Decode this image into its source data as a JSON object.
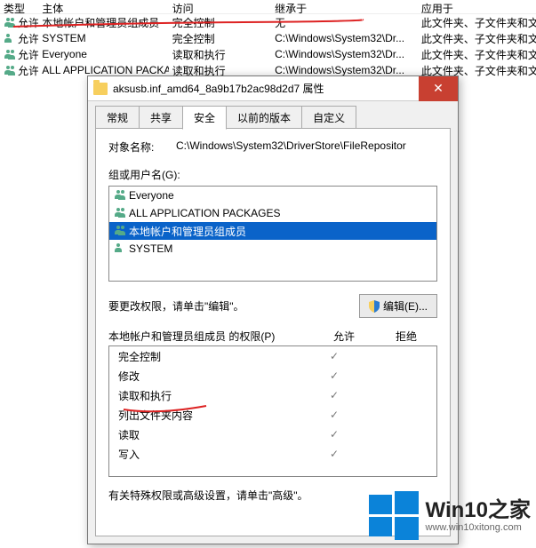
{
  "bg": {
    "headers": {
      "type": "类型",
      "principal": "主体",
      "access": "访问",
      "inherited": "继承于",
      "applies": "应用于"
    },
    "rows": [
      {
        "type": "允许",
        "principal": "本地帐户和管理员组成员",
        "access": "完全控制",
        "inherited": "无",
        "applies": "此文件夹、子文件夹和文件"
      },
      {
        "type": "允许",
        "principal": "SYSTEM",
        "access": "完全控制",
        "inherited": "C:\\Windows\\System32\\Dr...",
        "applies": "此文件夹、子文件夹和文件"
      },
      {
        "type": "允许",
        "principal": "Everyone",
        "access": "读取和执行",
        "inherited": "C:\\Windows\\System32\\Dr...",
        "applies": "此文件夹、子文件夹和文件"
      },
      {
        "type": "允许",
        "principal": "ALL APPLICATION PACKAGES",
        "access": "读取和执行",
        "inherited": "C:\\Windows\\System32\\Dr...",
        "applies": "此文件夹、子文件夹和文件"
      }
    ]
  },
  "dialog": {
    "title": "aksusb.inf_amd64_8a9b17b2ac98d2d7 属性",
    "tabs": [
      "常规",
      "共享",
      "安全",
      "以前的版本",
      "自定义"
    ],
    "active_tab": 2,
    "object_label": "对象名称:",
    "object_path": "C:\\Windows\\System32\\DriverStore\\FileRepositor",
    "group_label": "组或用户名(G):",
    "groups": [
      {
        "name": "Everyone",
        "multi": true
      },
      {
        "name": "ALL APPLICATION PACKAGES",
        "multi": true
      },
      {
        "name": "本地帐户和管理员组成员",
        "multi": true,
        "selected": true
      },
      {
        "name": "SYSTEM",
        "multi": false
      }
    ],
    "edit_note": "要更改权限，请单击\"编辑\"。",
    "edit_btn": "编辑(E)...",
    "perm_title_for": "本地帐户和管理员组成员 的权限(P)",
    "allow": "允许",
    "deny": "拒绝",
    "perms": [
      {
        "name": "完全控制",
        "allow": true,
        "deny": false
      },
      {
        "name": "修改",
        "allow": true,
        "deny": false
      },
      {
        "name": "读取和执行",
        "allow": true,
        "deny": false
      },
      {
        "name": "列出文件夹内容",
        "allow": true,
        "deny": false
      },
      {
        "name": "读取",
        "allow": true,
        "deny": false
      },
      {
        "name": "写入",
        "allow": true,
        "deny": false
      }
    ],
    "advanced_note": "有关特殊权限或高级设置，请单击\"高级\"。"
  },
  "watermark": {
    "brand": "Win10之家",
    "url": "www.win10xitong.com"
  },
  "colors": {
    "selection": "#0a63c9",
    "close": "#c84031",
    "winblue": "#0b83d9"
  }
}
